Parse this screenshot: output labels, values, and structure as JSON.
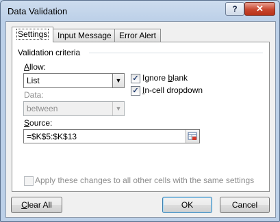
{
  "window": {
    "title": "Data Validation",
    "help_label": "?",
    "close_label": "✕"
  },
  "tabs": [
    {
      "label": "Settings",
      "active": true
    },
    {
      "label": "Input Message",
      "active": false
    },
    {
      "label": "Error Alert",
      "active": false
    }
  ],
  "criteria": {
    "group_label": "Validation criteria",
    "allow": {
      "label_pre": "",
      "label_u": "A",
      "label_post": "llow:",
      "value": "List"
    },
    "ignore_blank": {
      "label_pre": "Ignore ",
      "label_u": "b",
      "label_post": "lank",
      "checked": true
    },
    "in_cell_dropdown": {
      "label_pre": "",
      "label_u": "I",
      "label_post": "n-cell dropdown",
      "checked": true
    },
    "data": {
      "label": "Data:",
      "value": "between",
      "disabled": true
    },
    "source": {
      "label_pre": "",
      "label_u": "S",
      "label_post": "ource:",
      "value": "=$K$5:$K$13"
    },
    "apply_all": {
      "label": "Apply these changes to all other cells with the same settings",
      "checked": false,
      "disabled": true
    }
  },
  "buttons": {
    "clear_all": {
      "label_pre": "",
      "label_u": "C",
      "label_post": "lear All"
    },
    "ok": "OK",
    "cancel": "Cancel"
  }
}
